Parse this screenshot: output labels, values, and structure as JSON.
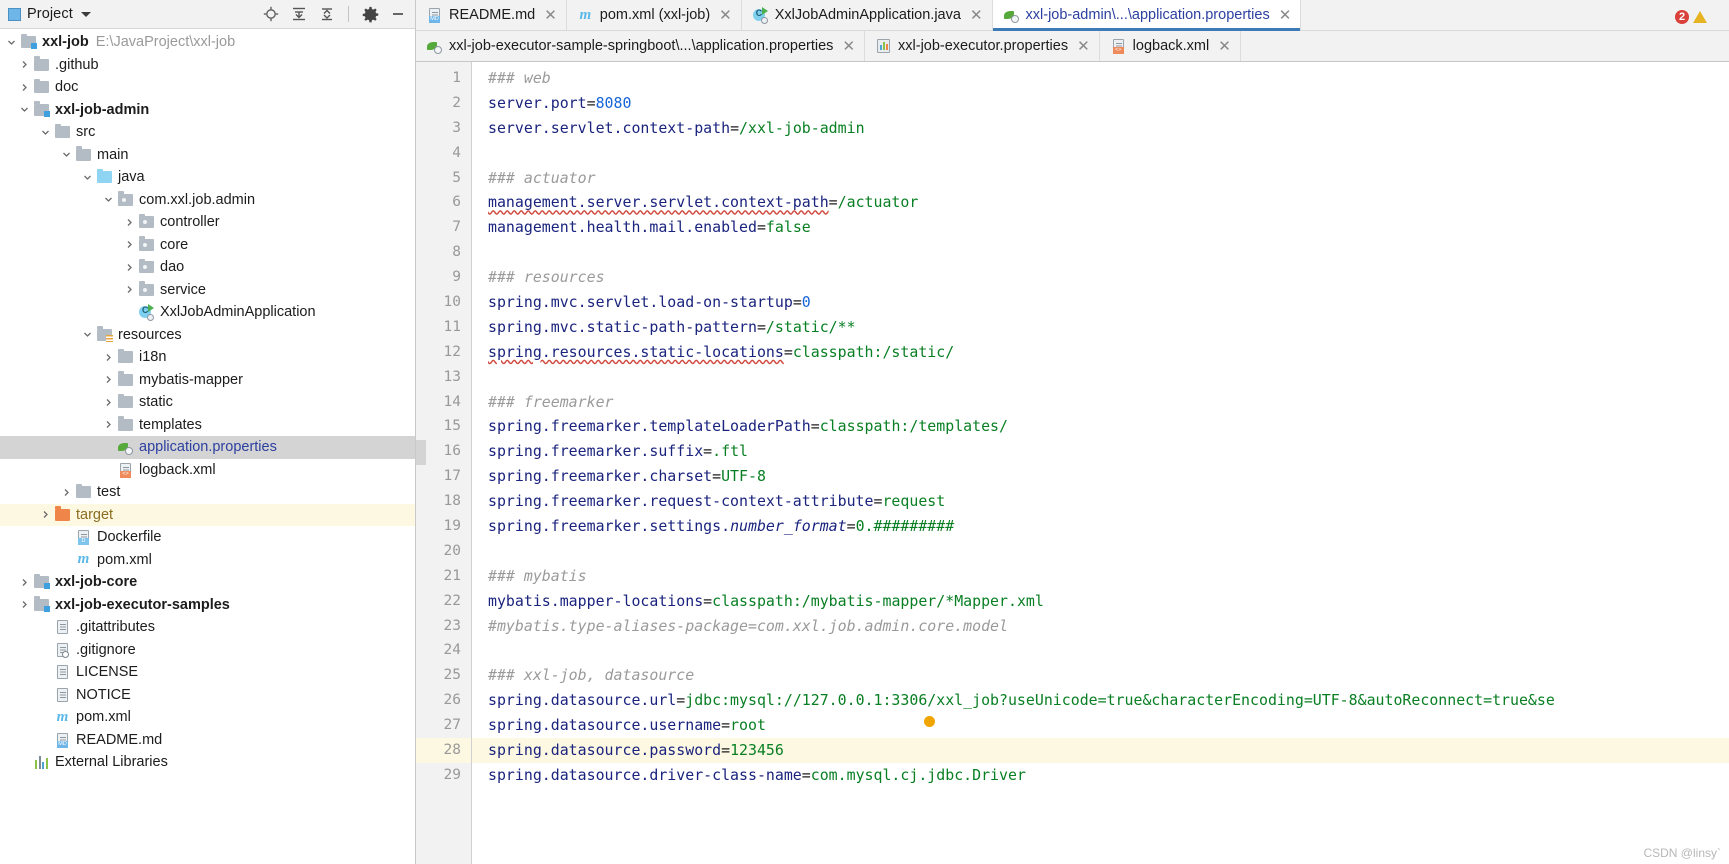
{
  "project_panel": {
    "title": "Project",
    "toolbar": [
      {
        "name": "locate-icon",
        "label": "Select Opened File"
      },
      {
        "name": "expand-all-icon",
        "label": "Expand All"
      },
      {
        "name": "collapse-all-icon",
        "label": "Collapse All"
      },
      {
        "name": "gear-icon",
        "label": "Settings"
      },
      {
        "name": "minimize-icon",
        "label": "Hide"
      }
    ],
    "tree": [
      {
        "indent": 0,
        "arrow": "down",
        "icon": "module-folder-icon",
        "label": "xxl-job",
        "bold": true,
        "path": "E:\\JavaProject\\xxl-job"
      },
      {
        "indent": 1,
        "arrow": "right",
        "icon": "folder-icon",
        "label": ".github"
      },
      {
        "indent": 1,
        "arrow": "right",
        "icon": "folder-icon",
        "label": "doc"
      },
      {
        "indent": 1,
        "arrow": "down",
        "icon": "module-folder-icon",
        "label": "xxl-job-admin",
        "bold": true
      },
      {
        "indent": 2,
        "arrow": "down",
        "icon": "folder-icon",
        "label": "src"
      },
      {
        "indent": 3,
        "arrow": "down",
        "icon": "folder-icon",
        "label": "main"
      },
      {
        "indent": 4,
        "arrow": "down",
        "icon": "source-folder-icon",
        "label": "java"
      },
      {
        "indent": 5,
        "arrow": "down",
        "icon": "package-icon",
        "label": "com.xxl.job.admin"
      },
      {
        "indent": 6,
        "arrow": "right",
        "icon": "package-icon",
        "label": "controller"
      },
      {
        "indent": 6,
        "arrow": "right",
        "icon": "package-icon",
        "label": "core"
      },
      {
        "indent": 6,
        "arrow": "right",
        "icon": "package-icon",
        "label": "dao"
      },
      {
        "indent": 6,
        "arrow": "right",
        "icon": "package-icon",
        "label": "service"
      },
      {
        "indent": 6,
        "arrow": "none",
        "icon": "spring-boot-class-icon",
        "label": "XxlJobAdminApplication"
      },
      {
        "indent": 4,
        "arrow": "down",
        "icon": "resources-folder-icon",
        "label": "resources"
      },
      {
        "indent": 5,
        "arrow": "right",
        "icon": "folder-icon",
        "label": "i18n"
      },
      {
        "indent": 5,
        "arrow": "right",
        "icon": "folder-icon",
        "label": "mybatis-mapper"
      },
      {
        "indent": 5,
        "arrow": "right",
        "icon": "folder-icon",
        "label": "static"
      },
      {
        "indent": 5,
        "arrow": "right",
        "icon": "folder-icon",
        "label": "templates"
      },
      {
        "indent": 5,
        "arrow": "none",
        "icon": "spring-properties-icon",
        "label": "application.properties",
        "state": "selected",
        "color": "blue"
      },
      {
        "indent": 5,
        "arrow": "none",
        "icon": "xml-file-icon",
        "label": "logback.xml"
      },
      {
        "indent": 3,
        "arrow": "right",
        "icon": "folder-icon",
        "label": "test"
      },
      {
        "indent": 2,
        "arrow": "right",
        "icon": "target-folder-icon",
        "label": "target",
        "state": "highlighted",
        "color": "orange"
      },
      {
        "indent": 3,
        "arrow": "none",
        "icon": "dockerfile-icon",
        "label": "Dockerfile"
      },
      {
        "indent": 3,
        "arrow": "none",
        "icon": "maven-icon",
        "label": "pom.xml"
      },
      {
        "indent": 1,
        "arrow": "right",
        "icon": "module-folder-icon",
        "label": "xxl-job-core",
        "bold": true
      },
      {
        "indent": 1,
        "arrow": "right",
        "icon": "module-folder-icon",
        "label": "xxl-job-executor-samples",
        "bold": true
      },
      {
        "indent": 2,
        "arrow": "none",
        "icon": "text-file-icon",
        "label": ".gitattributes"
      },
      {
        "indent": 2,
        "arrow": "none",
        "icon": "gitignore-icon",
        "label": ".gitignore"
      },
      {
        "indent": 2,
        "arrow": "none",
        "icon": "text-file-icon",
        "label": "LICENSE"
      },
      {
        "indent": 2,
        "arrow": "none",
        "icon": "text-file-icon",
        "label": "NOTICE"
      },
      {
        "indent": 2,
        "arrow": "none",
        "icon": "maven-icon",
        "label": "pom.xml"
      },
      {
        "indent": 2,
        "arrow": "none",
        "icon": "markdown-icon",
        "label": "README.md"
      },
      {
        "indent": 1,
        "arrow": "none",
        "icon": "external-libraries-icon",
        "label": "External Libraries"
      }
    ]
  },
  "editor": {
    "tabs_row1": [
      {
        "label": "README.md",
        "icon": "markdown-icon",
        "active": false,
        "closable": true
      },
      {
        "label": "pom.xml (xxl-job)",
        "icon": "maven-icon",
        "active": false,
        "closable": true
      },
      {
        "label": "XxlJobAdminApplication.java",
        "icon": "spring-boot-class-icon",
        "active": false,
        "closable": true
      },
      {
        "label": "xxl-job-admin\\...\\application.properties",
        "icon": "spring-properties-icon",
        "active": true,
        "closable": true
      }
    ],
    "tabs_row2": [
      {
        "label": "xxl-job-executor-sample-springboot\\...\\application.properties",
        "icon": "spring-properties-icon",
        "active": false,
        "closable": true
      },
      {
        "label": "xxl-job-executor.properties",
        "icon": "properties-chart-icon",
        "active": false,
        "closable": true
      },
      {
        "label": "logback.xml",
        "icon": "xml-file-icon",
        "active": false,
        "closable": true
      }
    ],
    "inspection": {
      "error_count": "2",
      "warning_present": true
    },
    "watermark": "CSDN @linsy`",
    "highlighted_line": 28,
    "lines": [
      {
        "n": 1,
        "type": "comment",
        "text": "### web"
      },
      {
        "n": 2,
        "type": "prop",
        "key": "server.port",
        "value": "8080",
        "value_kind": "number"
      },
      {
        "n": 3,
        "type": "prop",
        "key": "server.servlet.context-path",
        "value": "/xxl-job-admin"
      },
      {
        "n": 4,
        "type": "blank",
        "text": ""
      },
      {
        "n": 5,
        "type": "comment",
        "text": "### actuator"
      },
      {
        "n": 6,
        "type": "prop",
        "key": "management.server.servlet.context-path",
        "value": "/actuator",
        "spell": true
      },
      {
        "n": 7,
        "type": "prop",
        "key": "management.health.mail.enabled",
        "value": "false"
      },
      {
        "n": 8,
        "type": "blank",
        "text": ""
      },
      {
        "n": 9,
        "type": "comment",
        "text": "### resources"
      },
      {
        "n": 10,
        "type": "prop",
        "key": "spring.mvc.servlet.load-on-startup",
        "value": "0",
        "value_kind": "number"
      },
      {
        "n": 11,
        "type": "prop",
        "key": "spring.mvc.static-path-pattern",
        "value": "/static/**"
      },
      {
        "n": 12,
        "type": "prop",
        "key": "spring.resources.static-locations",
        "value": "classpath:/static/",
        "spell": true
      },
      {
        "n": 13,
        "type": "blank",
        "text": ""
      },
      {
        "n": 14,
        "type": "comment",
        "text": "### freemarker"
      },
      {
        "n": 15,
        "type": "prop",
        "key": "spring.freemarker.templateLoaderPath",
        "value": "classpath:/templates/"
      },
      {
        "n": 16,
        "type": "prop",
        "key": "spring.freemarker.suffix",
        "value": ".ftl"
      },
      {
        "n": 17,
        "type": "prop",
        "key": "spring.freemarker.charset",
        "value": "UTF-8"
      },
      {
        "n": 18,
        "type": "prop",
        "key": "spring.freemarker.request-context-attribute",
        "value": "request"
      },
      {
        "n": 19,
        "type": "prop",
        "key": "spring.freemarker.settings.",
        "key_italic": "number_format",
        "value": "0.#########"
      },
      {
        "n": 20,
        "type": "blank",
        "text": ""
      },
      {
        "n": 21,
        "type": "comment",
        "text": "### mybatis"
      },
      {
        "n": 22,
        "type": "prop",
        "key": "mybatis.mapper-locations",
        "value": "classpath:/mybatis-mapper/*Mapper.xml"
      },
      {
        "n": 23,
        "type": "comment",
        "text": "#mybatis.type-aliases-package=com.xxl.job.admin.core.model"
      },
      {
        "n": 24,
        "type": "blank",
        "text": ""
      },
      {
        "n": 25,
        "type": "comment",
        "text": "### xxl-job, datasource"
      },
      {
        "n": 26,
        "type": "prop",
        "key": "spring.datasource.url",
        "value": "jdbc:mysql://127.0.0.1:3306/xxl_job?useUnicode=true&characterEncoding=UTF-8&autoReconnect=true&se"
      },
      {
        "n": 27,
        "type": "prop",
        "key": "spring.datasource.username",
        "value": "root"
      },
      {
        "n": 28,
        "type": "prop",
        "key": "spring.datasource.password",
        "value": "123456"
      },
      {
        "n": 29,
        "type": "prop",
        "key": "spring.datasource.driver-class-name",
        "value": "com.mysql.cj.jdbc.Driver"
      }
    ]
  }
}
